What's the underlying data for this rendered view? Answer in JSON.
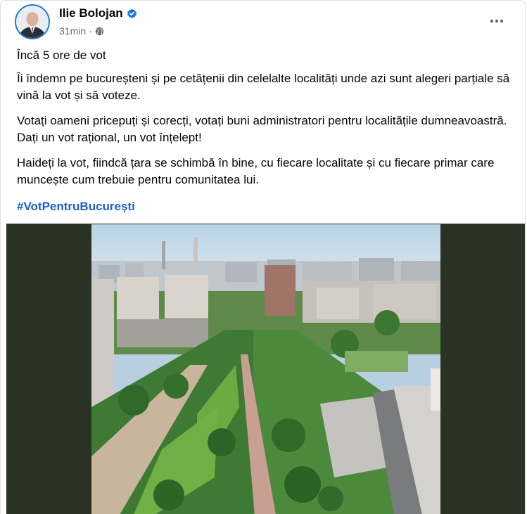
{
  "post": {
    "author": "Ilie Bolojan",
    "time": "31min",
    "separator": "·",
    "verified_icon": "verified-badge-icon",
    "audience_icon": "globe-icon",
    "more_icon": "more-options-icon",
    "paragraphs": [
      "Încă 5 ore de vot",
      "Îi îndemn pe bucureșteni și pe cetățenii din celelalte localități unde azi sunt alegeri parțiale să vină la vot și să voteze.",
      "Votați oameni pricepuți și corecți, votați buni administratori pentru localitățile dumneavoastră. Dați un vot rațional, un vot înțelept!",
      "Haideți la vot, fiindcă țara se schimbă în bine, cu fiecare localitate și cu fiecare primar care muncește cum trebuie pentru comunitatea lui."
    ],
    "hashtag": "#VotPentruBucurești"
  },
  "colors": {
    "link": "#1b5fd1",
    "verified": "#1b74e4",
    "secondary_text": "#65676b",
    "media_background": "#2a3223"
  }
}
